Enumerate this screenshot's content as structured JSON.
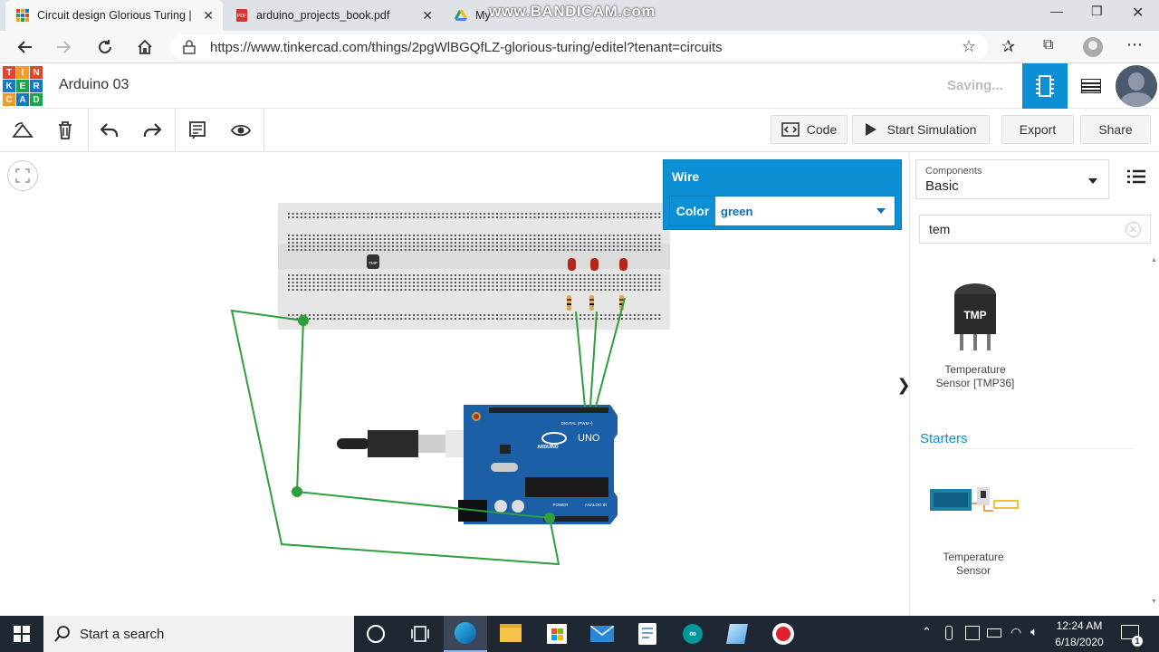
{
  "browser": {
    "tabs": [
      {
        "title": "Circuit design Glorious Turing | T",
        "active": true
      },
      {
        "title": "arduino_projects_book.pdf",
        "active": false
      },
      {
        "title": "My",
        "active": false
      }
    ],
    "watermark": "www.BANDICAM.com",
    "url": "https://www.tinkercad.com/things/2pgWlBGQfLZ-glorious-turing/editel?tenant=circuits"
  },
  "app": {
    "logo_letters": [
      "T",
      "I",
      "N",
      "K",
      "E",
      "R",
      "C",
      "A",
      "D"
    ],
    "project_title": "Arduino 03",
    "status": "Saving..."
  },
  "toolbar": {
    "code_label": "Code",
    "start_sim_label": "Start Simulation",
    "export_label": "Export",
    "share_label": "Share"
  },
  "wire_panel": {
    "title": "Wire",
    "color_label": "Color",
    "color_value": "green"
  },
  "components": {
    "caption": "Components",
    "category": "Basic",
    "search_value": "tem",
    "results": [
      {
        "chip_text": "TMP",
        "label_line1": "Temperature",
        "label_line2": "Sensor [TMP36]"
      }
    ],
    "starters_title": "Starters",
    "starters": [
      {
        "label_line1": "Temperature",
        "label_line2": "Sensor"
      }
    ]
  },
  "circuit": {
    "tmp_chip_text": "TMP",
    "board_text": "UNO",
    "board_brand": "ARDUINO",
    "wire_color": "#2e9e3e",
    "board_color": "#1b5fa6",
    "digital_label": "DIGITAL (PWM~)",
    "power_label": "POWER",
    "analog_label": "ANALOG IN"
  },
  "taskbar": {
    "search_placeholder": "Start a search",
    "time": "12:24 AM",
    "date": "6/18/2020",
    "notification_count": "1"
  },
  "colors": {
    "accent": "#0d8fd6",
    "logo_red": "#e8422a",
    "logo_orange": "#f59b25",
    "logo_blue": "#1478c6",
    "logo_green": "#19a64b"
  }
}
